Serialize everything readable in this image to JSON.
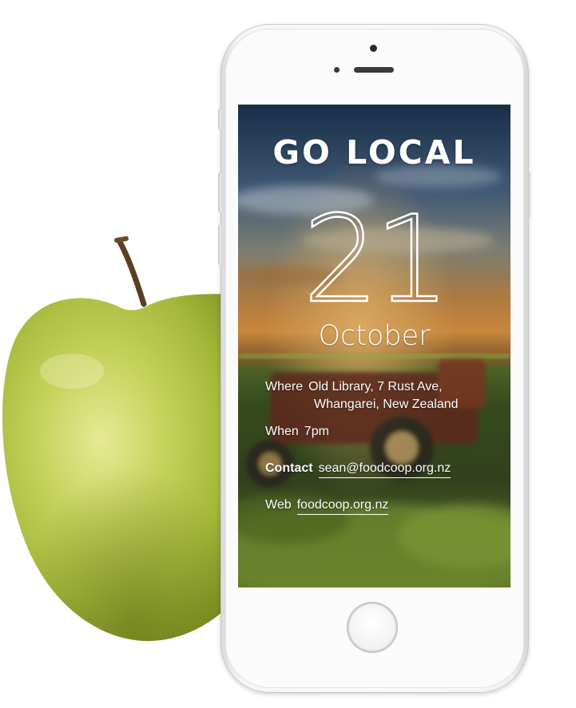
{
  "screen": {
    "title": "GO LOCAL",
    "day": "21",
    "month": "October",
    "where": {
      "label": "Where",
      "line1": "Old Library, 7 Rust Ave,",
      "line2": "Whangarei, New Zealand"
    },
    "when": {
      "label": "When",
      "value": "7pm"
    },
    "contact": {
      "label": "Contact",
      "email": "sean@foodcoop.org.nz"
    },
    "web": {
      "label": "Web",
      "url": "foodcoop.org.nz"
    }
  },
  "icons": [
    "apple-illustration",
    "phone-camera-icon",
    "home-button-icon"
  ],
  "colors": {
    "phone_body": "#f7f7f8",
    "sky_top": "#1d3550",
    "sunset": "#e48a3a",
    "field": "#6f8a2c",
    "apple_green": "#b6c84a"
  }
}
